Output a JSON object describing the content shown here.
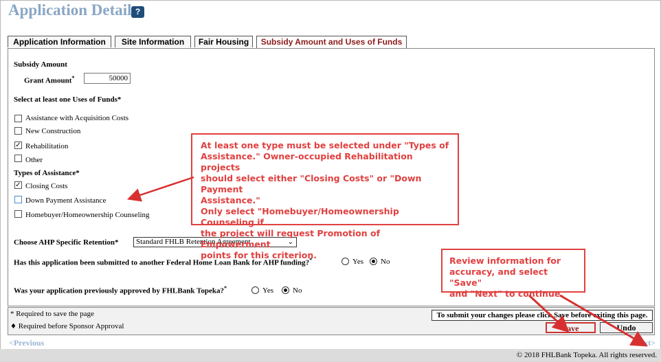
{
  "title": "Application Details",
  "help_icon": "?",
  "tabs": [
    {
      "label": "Application Information"
    },
    {
      "label": "Site Information"
    },
    {
      "label": "Fair Housing"
    },
    {
      "label": "Subsidy Amount and Uses of Funds"
    }
  ],
  "subsidy": {
    "heading": "Subsidy Amount",
    "grant_label": "Grant Amount",
    "required_mark": "*",
    "grant_value": "50000"
  },
  "uses": {
    "heading": "Select at least one Uses of Funds*",
    "items": [
      {
        "label": "Assistance with Acquisition Costs",
        "checked": ""
      },
      {
        "label": "New Construction",
        "checked": ""
      },
      {
        "label": "Rehabilitation",
        "checked": "✓"
      },
      {
        "label": "Other",
        "checked": ""
      }
    ]
  },
  "assistance": {
    "heading": "Types of Assistance*",
    "items": [
      {
        "label": "Closing Costs",
        "checked": "✓"
      },
      {
        "label": "Down Payment Assistance",
        "checked": ""
      },
      {
        "label": "Homebuyer/Homeownership Counseling",
        "checked": ""
      }
    ]
  },
  "retention": {
    "label": "Choose AHP Specific Retention*",
    "selected": "Standard FHLB Retention Agreement",
    "chevron": "⌄"
  },
  "q1": {
    "label": "Has this application been submitted to another Federal Home Loan Bank for AHP funding?",
    "req": "*",
    "yes": "Yes",
    "no": "No",
    "selected": "No"
  },
  "q2": {
    "label": "Was your application previously approved by FHLBank Topeka?",
    "req": "*",
    "yes": "Yes",
    "no": "No",
    "selected": "No"
  },
  "callout1": {
    "lines": [
      "At least one type must be selected under \"Types of",
      "Assistance.\" Owner-occupied Rehabilitation projects",
      "should select either \"Closing Costs\" or \"Down Payment",
      "Assistance.\"",
      "Only select \"Homebuyer/Homeownership Counseling if",
      "the project will request Promotion of Empowerment",
      "points for this criterion."
    ]
  },
  "callout2": {
    "lines": [
      "Review information for",
      "accuracy, and select \"Save\"",
      "and \"Next\" to continue."
    ]
  },
  "footer": {
    "required_note": "* Required to save the page",
    "diamond": "♦",
    "sponsor_note": "Required before Sponsor Approval",
    "submit_note": "To submit your changes please click Save before exiting this page.",
    "save": "Save",
    "undo": "Undo"
  },
  "nav": {
    "previous": "<Previous",
    "next": "Next>"
  },
  "copyright": "© 2018 FHLBank Topeka. All rights reserved.",
  "colors": {
    "title": "#8aa6c6",
    "active_tab": "#8b1a1a",
    "callout": "#e14040"
  }
}
